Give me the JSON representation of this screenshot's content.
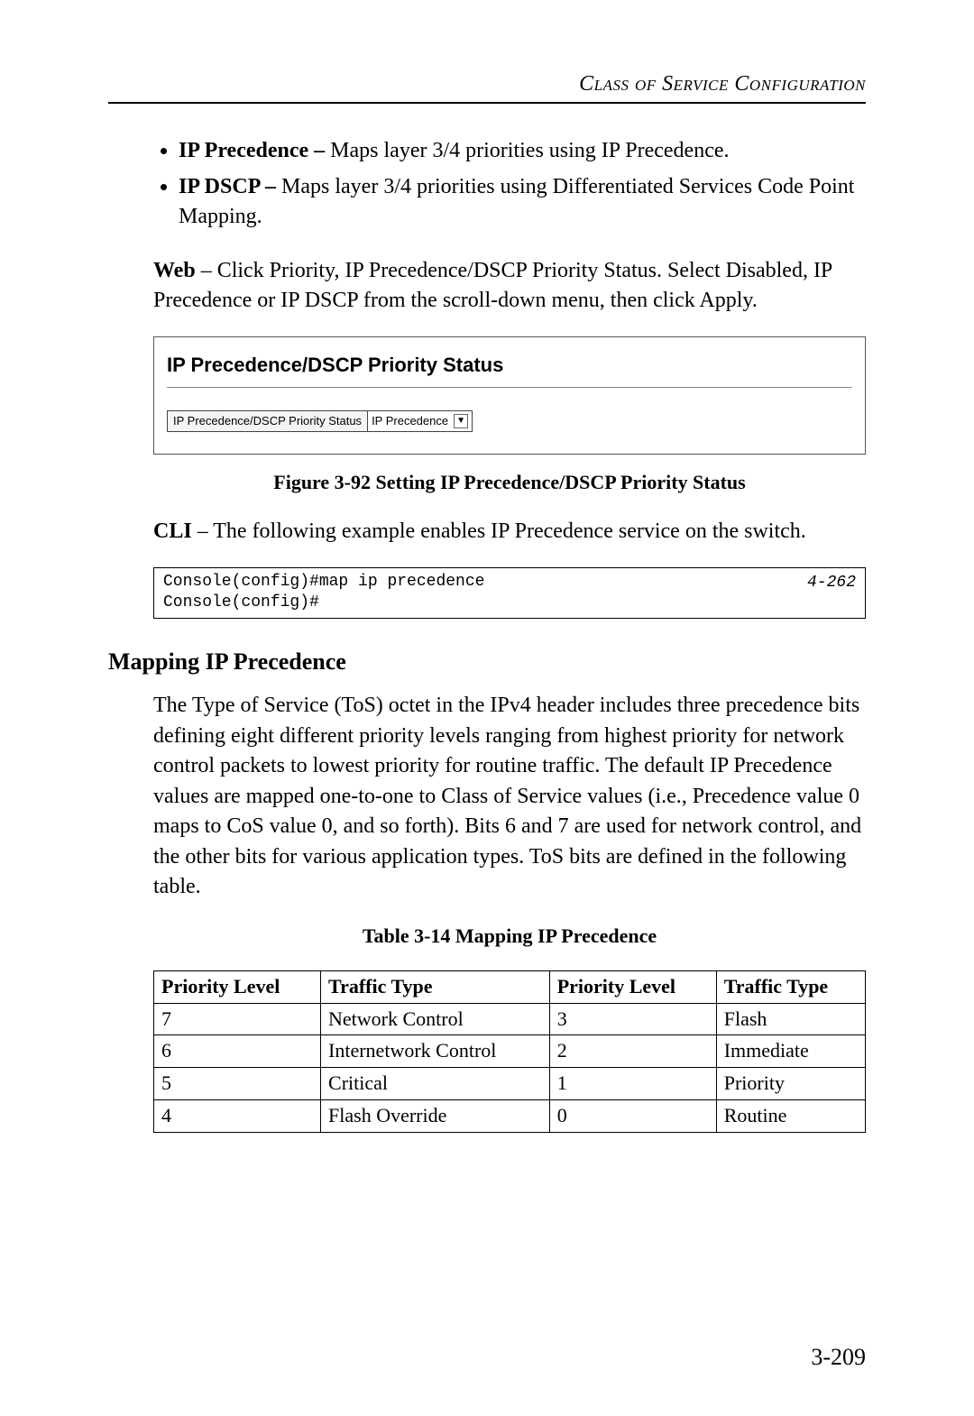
{
  "running_head": "Class of Service Configuration",
  "bullets": [
    {
      "term": "IP Precedence – ",
      "rest": "Maps layer 3/4 priorities using IP Precedence."
    },
    {
      "term": "IP DSCP – ",
      "rest": "Maps layer 3/4 priorities using Differentiated Services Code Point Mapping."
    }
  ],
  "web_para": {
    "lead": "Web",
    "rest": " – Click Priority, IP Precedence/DSCP Priority Status. Select Disabled, IP Precedence or IP DSCP from the scroll-down menu, then click Apply."
  },
  "panel": {
    "title": "IP Precedence/DSCP Priority Status",
    "row_label": "IP Precedence/DSCP Priority Status",
    "selected": "IP Precedence"
  },
  "figure_caption": "Figure 3-92  Setting IP Precedence/DSCP Priority Status",
  "cli_para": {
    "lead": "CLI",
    "rest": " – The following example enables IP Precedence service on the switch."
  },
  "cli_block": {
    "lines": "Console(config)#map ip precedence\nConsole(config)#",
    "ref": "4-262"
  },
  "section_heading": "Mapping IP Precedence",
  "section_body": "The Type of Service (ToS) octet in the IPv4 header includes three precedence bits defining eight different priority levels ranging from highest priority for network control packets to lowest priority for routine traffic. The default IP Precedence values are mapped one-to-one to Class of Service values (i.e., Precedence value 0 maps to CoS value 0, and so forth). Bits 6 and 7 are used for network control, and the other bits for various application types. ToS bits are defined in the following table.",
  "table_caption": "Table 3-14  Mapping IP Precedence",
  "table": {
    "headers": [
      "Priority Level",
      "Traffic Type",
      "Priority Level",
      "Traffic Type"
    ],
    "rows": [
      [
        "7",
        "Network Control",
        "3",
        "Flash"
      ],
      [
        "6",
        "Internetwork Control",
        "2",
        "Immediate"
      ],
      [
        "5",
        "Critical",
        "1",
        "Priority"
      ],
      [
        "4",
        "Flash Override",
        "0",
        "Routine"
      ]
    ]
  },
  "page_number": "3-209"
}
